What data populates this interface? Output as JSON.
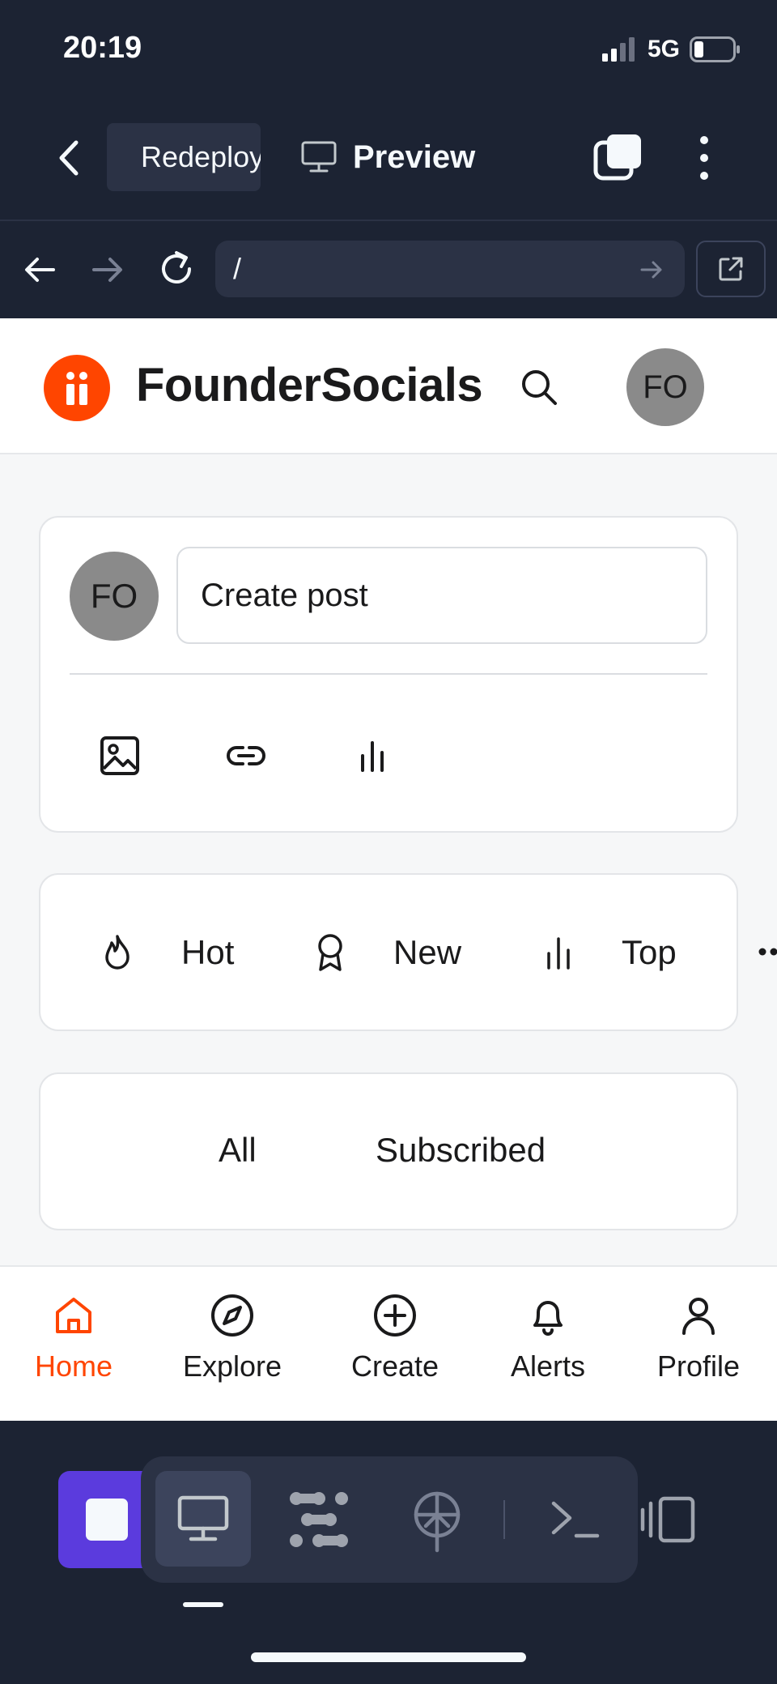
{
  "status_bar": {
    "time": "20:19",
    "network": "5G",
    "battery_level": 0.2
  },
  "browser": {
    "tabs": [
      {
        "label": "Redeploy",
        "icon": "deploy-icon"
      },
      {
        "label": "Preview",
        "icon": "monitor-icon"
      }
    ],
    "url": "/"
  },
  "app": {
    "title": "FounderSocials",
    "accent_color": "#ff4500",
    "user_initials": "FO",
    "create_post_placeholder": "Create post",
    "post_tools": [
      "image-icon",
      "link-icon",
      "poll-icon"
    ],
    "sort_options": [
      {
        "label": "Hot",
        "icon": "flame-icon"
      },
      {
        "label": "New",
        "icon": "award-icon"
      },
      {
        "label": "Top",
        "icon": "bar-chart-icon"
      }
    ],
    "feed_filters": [
      "All",
      "Subscribed"
    ],
    "bottom_nav": [
      {
        "label": "Home",
        "icon": "home-icon",
        "active": true
      },
      {
        "label": "Explore",
        "icon": "compass-icon",
        "active": false
      },
      {
        "label": "Create",
        "icon": "plus-circle-icon",
        "active": false
      },
      {
        "label": "Alerts",
        "icon": "bell-icon",
        "active": false
      },
      {
        "label": "Profile",
        "icon": "user-icon",
        "active": false
      }
    ]
  },
  "dock": {
    "items": [
      "stop-icon",
      "monitor-icon",
      "workflows-icon",
      "deploy-icon",
      "shell-icon",
      "layout-icon"
    ],
    "stop_color": "#5b3bdd"
  }
}
